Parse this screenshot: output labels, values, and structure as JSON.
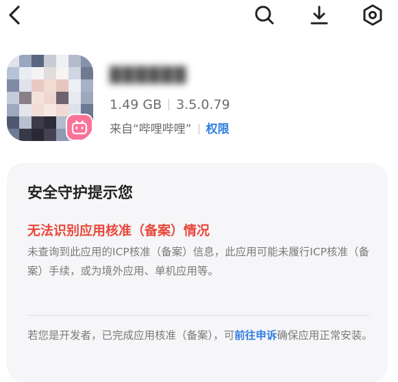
{
  "topbar": {
    "icons": [
      "back-arrow-icon",
      "search-icon",
      "download-icon",
      "settings-hexagon-icon"
    ]
  },
  "app": {
    "name": "██████",
    "size": "1.49 GB",
    "version": "3.5.0.79",
    "source": "来自“哔哩哔哩”",
    "permissions_label": "权限",
    "badge_color": "#fb7299"
  },
  "security_card": {
    "title": "安全守护提示您",
    "warning_title": "无法识别应用核准（备案）情况",
    "warning_body": "未查询到此应用的ICP核准（备案）信息，此应用可能未履行ICP核准（备案）手续，或为境外应用、单机应用等。",
    "developer_note_prefix": "若您是开发者，已完成应用核准（备案），可",
    "appeal_link": "前往申诉",
    "developer_note_suffix": "确保应用正常安装。",
    "warning_color": "#e8473a",
    "link_color": "#2f7de1"
  }
}
